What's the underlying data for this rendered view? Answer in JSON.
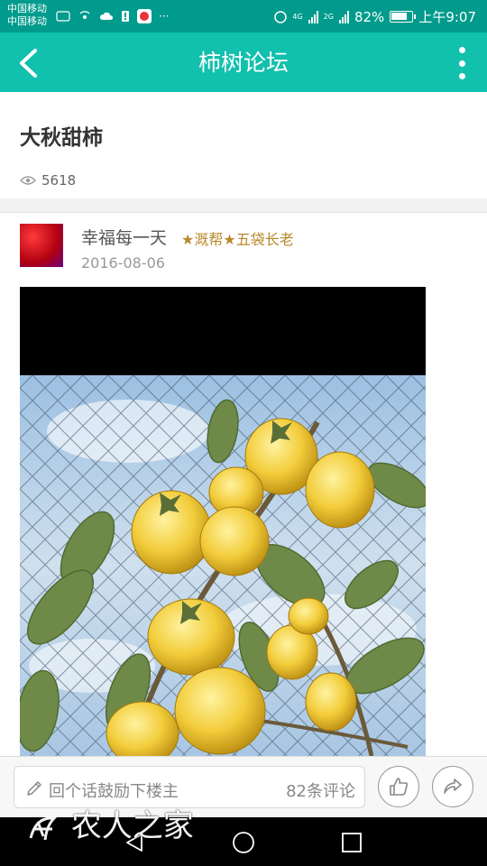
{
  "status_bar": {
    "carrier_1": "中国移动",
    "carrier_2": "中国移动",
    "more": "···",
    "net_4g": "4G",
    "net_2g": "2G",
    "battery_percent": "82%",
    "battery_level": 0.82,
    "time": "上午9:07"
  },
  "app_bar": {
    "title": "柿树论坛"
  },
  "post": {
    "title": "大秋甜柿",
    "view_count": "5618",
    "author": "幸福每一天",
    "badge": "★溉帮★五袋长老",
    "date": "2016-08-06"
  },
  "bottom_bar": {
    "comment_placeholder": "回个话鼓励下楼主",
    "comment_count": "82条评论"
  },
  "watermark": "农人之家",
  "colors": {
    "status_bar": "#009b8c",
    "app_bar": "#11c0ad",
    "badge": "#b8892a"
  }
}
